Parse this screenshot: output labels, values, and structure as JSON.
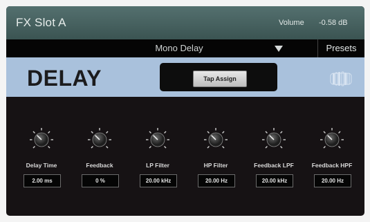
{
  "window": {
    "title": "FX Slot A",
    "volume_label": "Volume",
    "volume_value": "-0.58 dB"
  },
  "effect_bar": {
    "selected_effect": "Mono Delay",
    "presets_label": "Presets"
  },
  "header": {
    "effect_name": "DELAY",
    "tap_button_label": "Tap Assign",
    "logo": "presonus-logo"
  },
  "controls": [
    {
      "label": "Delay Time",
      "value": "2.00 ms"
    },
    {
      "label": "Feedback",
      "value": "0 %"
    },
    {
      "label": "LP Filter",
      "value": "20.00 kHz"
    },
    {
      "label": "HP Filter",
      "value": "20.00 Hz"
    },
    {
      "label": "Feedback LPF",
      "value": "20.00 kHz"
    },
    {
      "label": "Feedback HPF",
      "value": "20.00 Hz"
    }
  ],
  "colors": {
    "title_bar": "#4a6563",
    "header_bar": "#a9c1dc",
    "panel_bg": "#161214"
  }
}
